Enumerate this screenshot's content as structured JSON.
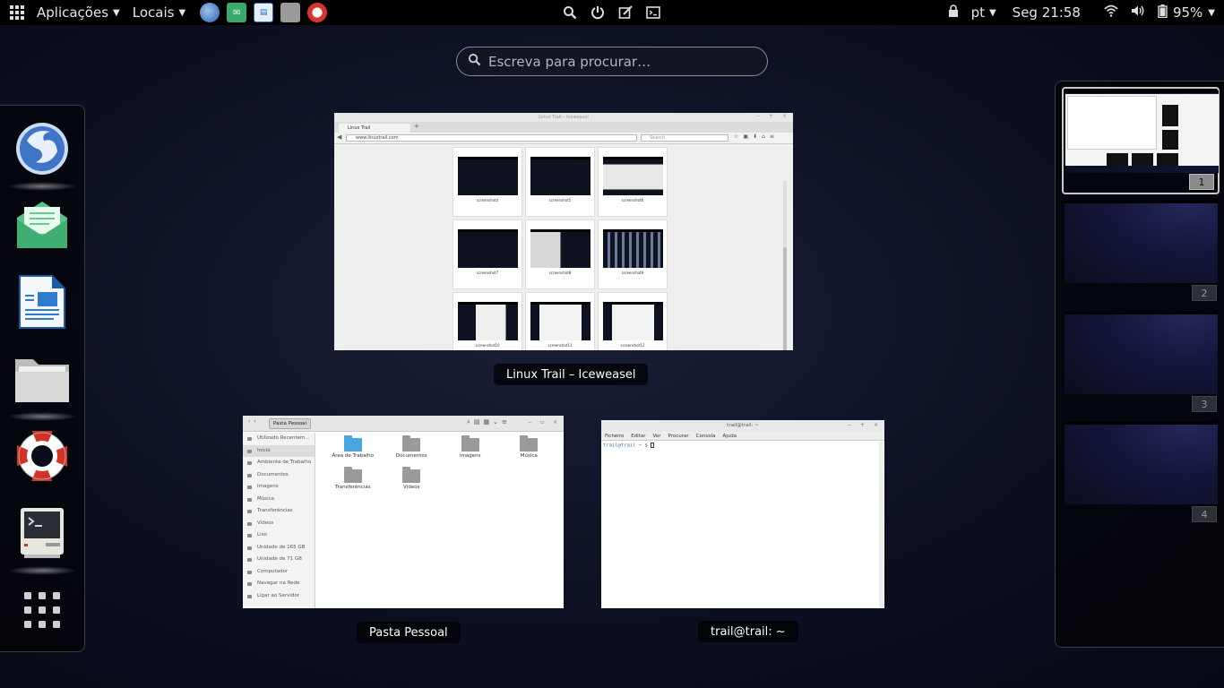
{
  "topbar": {
    "applications_label": "Aplicações",
    "places_label": "Locais",
    "keyboard_layout": "pt",
    "clock": "Seg 21:58",
    "battery": "95%",
    "quick_launch": [
      "iceweasel-icon",
      "mail-icon",
      "writer-icon",
      "files-icon",
      "help-icon"
    ],
    "center_icons": [
      "search-icon",
      "logout-icon",
      "edit-icon",
      "terminal-icon"
    ]
  },
  "search": {
    "placeholder": "Escreva para procurar…"
  },
  "dash": {
    "items": [
      "iceweasel",
      "mail",
      "libreoffice-writer",
      "files",
      "help",
      "terminal",
      "show-applications"
    ]
  },
  "windows": {
    "browser": {
      "caption": "Linux Trail – Iceweasel",
      "title": "Linux Trail – Iceweasel",
      "tab_label": "Linux Trail",
      "url": "www.linuxtrail.com",
      "search_placeholder": "Search",
      "thumbnails": [
        "screenshot4",
        "screenshot5",
        "screenshot6",
        "screenshot7",
        "screenshot8",
        "screenshot9",
        "screenshot10",
        "screenshot11",
        "screenshot12"
      ]
    },
    "files": {
      "caption": "Pasta Pessoal",
      "path_label": "Pasta Pessoal",
      "sidebar": [
        "Utilizado Recentem...",
        "Início",
        "Ambiente de Trabalho",
        "Documentos",
        "Imagens",
        "Música",
        "Transferências",
        "Vídeos",
        "Lixo",
        "Unidade de 165 GB",
        "Unidade de 71 GB",
        "Computador",
        "Navegar na Rede",
        "Ligar ao Servidor"
      ],
      "folders": [
        "Área de Trabalho",
        "Documentos",
        "Imagens",
        "Música",
        "Transferências",
        "Vídeos"
      ]
    },
    "terminal": {
      "caption": "trail@trail: ~",
      "title": "trail@trail: ~",
      "menu": [
        "Ficheiro",
        "Editar",
        "Ver",
        "Procurar",
        "Consola",
        "Ajuda"
      ],
      "prompt": "trail@trail ~ $ "
    }
  },
  "workspaces": [
    "1",
    "2",
    "3",
    "4"
  ],
  "colors": {
    "topbar": "#000000",
    "desktop": "#0c1022",
    "accent_blue": "#4aa6e0"
  }
}
